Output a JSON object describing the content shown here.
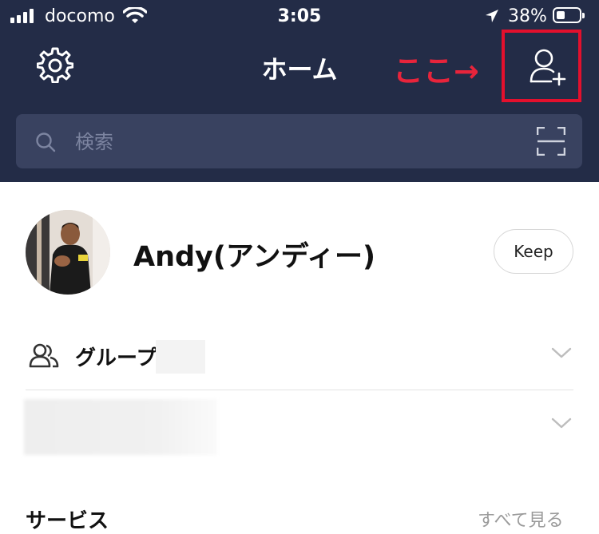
{
  "status_bar": {
    "carrier": "docomo",
    "time": "3:05",
    "battery_percent": "38%",
    "signal_bars": 4,
    "battery_level": 0.38
  },
  "nav": {
    "title": "ホーム",
    "annotation": "ここ→",
    "settings_icon": "gear-icon",
    "add_friend_icon": "add-friend-icon",
    "highlight_color": "#e3102d"
  },
  "search": {
    "placeholder": "検索",
    "scan_icon": "qr-scan-icon"
  },
  "profile": {
    "name": "Andy(アンディー)",
    "keep_label": "Keep"
  },
  "sections": {
    "groups_label": "グループ",
    "services_title": "サービス",
    "see_all_label": "すべて見る"
  },
  "colors": {
    "header_bg": "#232c47",
    "search_bg": "#394260",
    "annotation": "#e8243b"
  }
}
